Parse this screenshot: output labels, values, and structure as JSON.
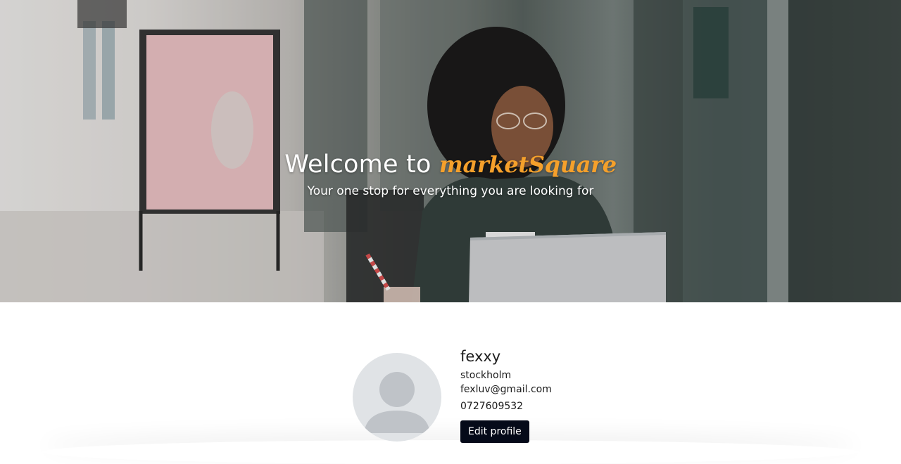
{
  "hero": {
    "title_prefix": "Welcome to",
    "brand": "marketSquare",
    "subtitle": "Your one stop for everything you are looking for"
  },
  "profile": {
    "username": "fexxy",
    "city": "stockholm",
    "email": "fexluv@gmail.com",
    "phone": "0727609532",
    "edit_label": "Edit profile"
  },
  "colors": {
    "brand_accent": "#f5a02b",
    "button_bg": "#050a19",
    "avatar_bg": "#e0e3e6",
    "avatar_figure": "#bfc3c8"
  }
}
